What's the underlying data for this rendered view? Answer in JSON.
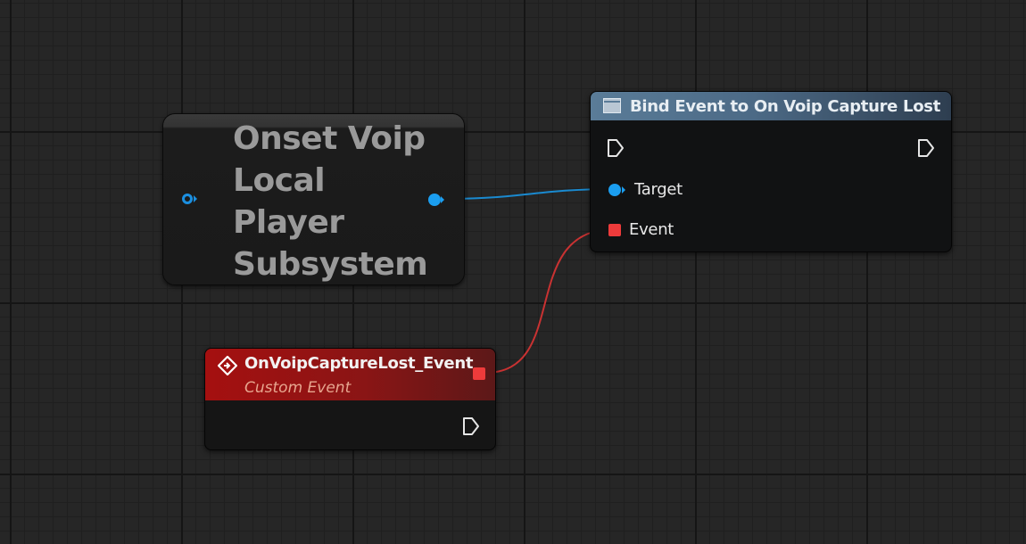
{
  "getter_node": {
    "title": "Onset Voip Local Player Subsystem"
  },
  "function_node": {
    "title": "Bind Event to On Voip Capture Lost",
    "pins": {
      "target_label": "Target",
      "event_label": "Event"
    }
  },
  "event_node": {
    "title": "OnVoipCaptureLost_Event",
    "subtitle": "Custom Event"
  },
  "colors": {
    "object_pin": "#1b9ef0",
    "delegate_pin": "#ee3b3b",
    "function_header": "#5a7c98",
    "event_header": "#a51010"
  },
  "icons": [
    "function-icon",
    "custom-event-icon",
    "exec-pin-icon"
  ]
}
